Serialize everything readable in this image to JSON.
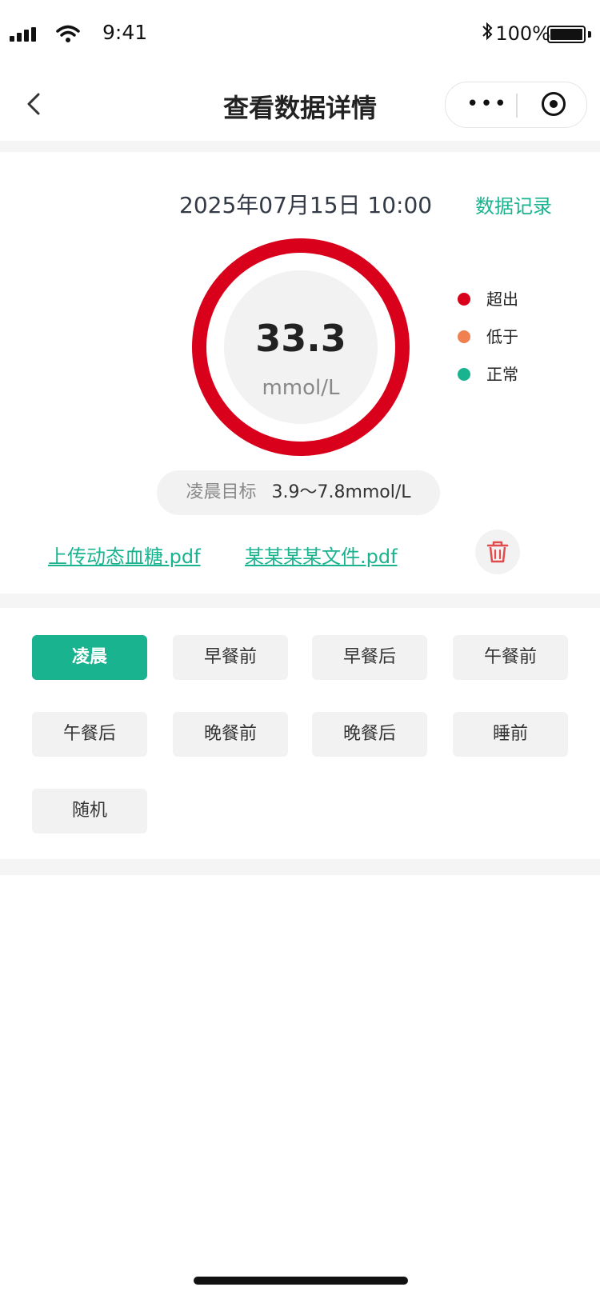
{
  "status_bar": {
    "time": "9:41",
    "battery": "100%",
    "icons": [
      "signal-icon",
      "wifi-icon",
      "bluetooth-icon",
      "battery-icon"
    ]
  },
  "nav": {
    "title": "查看数据详情",
    "capsule_more": "•••"
  },
  "reading": {
    "datetime": "2025年07月15日  10:00",
    "record_link": "数据记录",
    "value": "33.3",
    "unit": "mmol/L",
    "status_color": "#d9001b",
    "legend": [
      {
        "label": "超出",
        "color": "#d9001b"
      },
      {
        "label": "低于",
        "color": "#f08050"
      },
      {
        "label": "正常",
        "color": "#1ab38f"
      }
    ],
    "target_label": "凌晨目标",
    "target_value": "3.9～7.8mmol/L"
  },
  "files": [
    {
      "name": "上传动态血糖.pdf"
    },
    {
      "name": "某某某某文件.pdf"
    }
  ],
  "periods": {
    "selected": "凌晨",
    "items": [
      "凌晨",
      "早餐前",
      "早餐后",
      "午餐前",
      "午餐后",
      "晚餐前",
      "晚餐后",
      "睡前",
      "随机"
    ]
  },
  "colors": {
    "accent": "#1ab38f",
    "danger": "#d9001b",
    "chip_bg": "#f2f2f2"
  }
}
